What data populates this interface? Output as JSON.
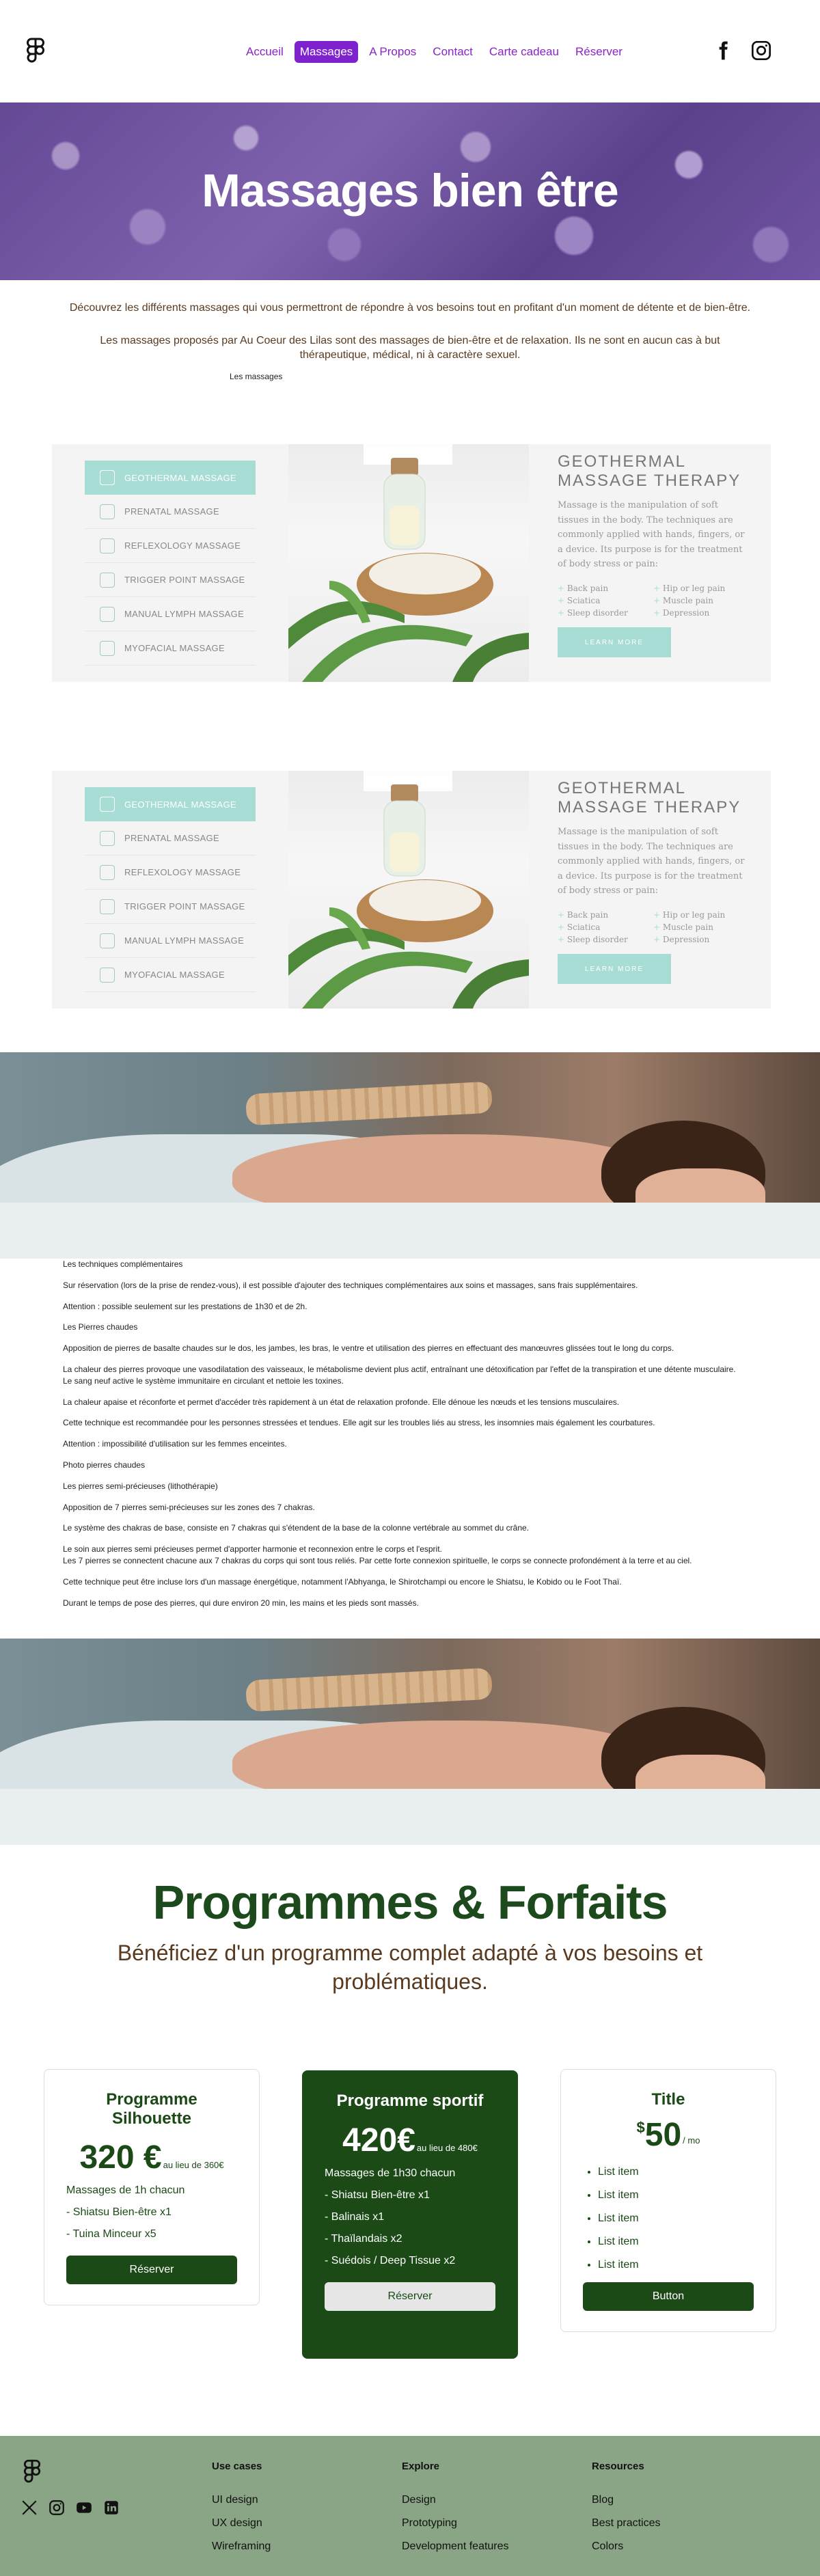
{
  "nav": {
    "items": [
      {
        "label": "Accueil",
        "active": false
      },
      {
        "label": "Massages",
        "active": true
      },
      {
        "label": "A Propos",
        "active": false
      },
      {
        "label": "Contact",
        "active": false
      },
      {
        "label": "Carte cadeau",
        "active": false
      },
      {
        "label": "Réserver",
        "active": false
      }
    ],
    "social": [
      "facebook-icon",
      "instagram-icon"
    ]
  },
  "hero": {
    "title": "Massages bien être"
  },
  "intro": {
    "p1": "Découvrez les différents massages qui vous permettront de répondre à vos besoins tout en profitant d'un moment de détente et de bien-être.",
    "p2": "Les massages proposés par Au Coeur des Lilas sont des massages de bien-être et de relaxation. Ils ne sont en aucun cas à but thérapeutique, médical, ni à caractère sexuel.",
    "small": "Les massages"
  },
  "panel": {
    "menu": [
      "GEOTHERMAL MASSAGE",
      "PRENATAL MASSAGE",
      "REFLEXOLOGY MASSAGE",
      "TRIGGER POINT MASSAGE",
      "MANUAL LYMPH MASSAGE",
      "MYOFACIAL MASSAGE"
    ],
    "title": "GEOTHERMAL MASSAGE THERAPY",
    "desc": "Massage is the manipulation of soft tissues in the body. The techniques are commonly applied with hands, fingers, or a device. Its purpose is for the treatment of body stress or pain:",
    "list": [
      "Back pain",
      "Hip or leg pain",
      "Sciatica",
      "Muscle pain",
      "Sleep disorder",
      "Depression"
    ],
    "button": "LEARN MORE"
  },
  "text": {
    "paragraphs": [
      "Les techniques complémentaires",
      "Sur réservation (lors de la prise de rendez-vous), il est possible d'ajouter des techniques complémentaires aux soins et massages, sans frais supplémentaires.",
      "Attention : possible seulement sur les prestations de 1h30 et de 2h.",
      "Les Pierres chaudes",
      "Apposition de pierres de basalte chaudes sur le dos, les jambes, les bras, le ventre et utilisation des pierres en effectuant des manœuvres glissées tout le long du corps.",
      "La chaleur des pierres provoque une vasodilatation des vaisseaux, le métabolisme devient plus actif, entraînant une détoxification par l'effet de la transpiration et une détente musculaire.",
      "Le sang neuf active le système immunitaire en circulant et nettoie les toxines.",
      "La chaleur apaise et réconforte et permet d'accéder très rapidement à un état de relaxation profonde. Elle dénoue les nœuds et les tensions musculaires.",
      "Cette technique est recommandée pour les personnes stressées et tendues. Elle agit sur les troubles liés au stress, les insomnies mais également les courbatures.",
      "Attention : impossibilité d'utilisation sur les femmes enceintes.",
      "Photo pierres chaudes",
      "Les pierres semi-précieuses (lithothérapie)",
      "Apposition de 7 pierres semi-précieuses sur les zones des 7 chakras.",
      "Le système des chakras de base, consiste en 7 chakras qui s'étendent de la base de la colonne vertébrale au sommet du crâne.",
      "Le soin aux pierres semi précieuses permet d'apporter harmonie et reconnexion entre le corps et l'esprit.",
      "Les 7 pierres se connectent chacune aux 7 chakras du corps qui sont tous reliés. Par cette forte connexion spirituelle, le corps se connecte profondément à la terre et au ciel.",
      "Cette technique peut être incluse lors d'un massage énergétique, notamment l'Abhyanga, le Shirotchampi ou encore le Shiatsu, le Kobido ou le Foot Thaï.",
      "Durant le temps de pose des pierres, qui dure environ 20 min, les mains et les pieds sont massés."
    ]
  },
  "programmes": {
    "title": "Programmes & Forfaits",
    "subtitle": "Bénéficiez d'un programme complet adapté à vos besoins et problématiques.",
    "cards": [
      {
        "title": "Programme Silhouette",
        "price": "320 €",
        "note": "au lieu de 360€",
        "sub": "Massages de 1h chacun",
        "lines": [
          "- Shiatsu Bien-être x1",
          "- Tuina Minceur x5"
        ],
        "button": "Réserver"
      },
      {
        "title": "Programme sportif",
        "price": "420€",
        "note": "au lieu de 480€",
        "sub": "Massages de 1h30 chacun",
        "lines": [
          "- Shiatsu Bien-être x1",
          "- Balinais x1",
          "- Thaïlandais x2",
          "- Suédois / Deep Tissue x2"
        ],
        "button": "Réserver"
      },
      {
        "title": "Title",
        "currency": "$",
        "price": "50",
        "per": "/ mo",
        "items": [
          "List item",
          "List item",
          "List item",
          "List item",
          "List item"
        ],
        "button": "Button"
      }
    ]
  },
  "footer": {
    "columns": [
      {
        "title": "Use cases",
        "links": [
          "UI design",
          "UX design",
          "Wireframing"
        ]
      },
      {
        "title": "Explore",
        "links": [
          "Design",
          "Prototyping",
          "Development features"
        ]
      },
      {
        "title": "Resources",
        "links": [
          "Blog",
          "Best practices",
          "Colors"
        ]
      }
    ],
    "social": [
      "x-icon",
      "instagram-icon",
      "youtube-icon",
      "linkedin-icon"
    ]
  },
  "colors": {
    "accent": "#7e22ce",
    "green": "#1b4a17",
    "teal": "#a8ddd6",
    "footer": "#8aa585"
  }
}
